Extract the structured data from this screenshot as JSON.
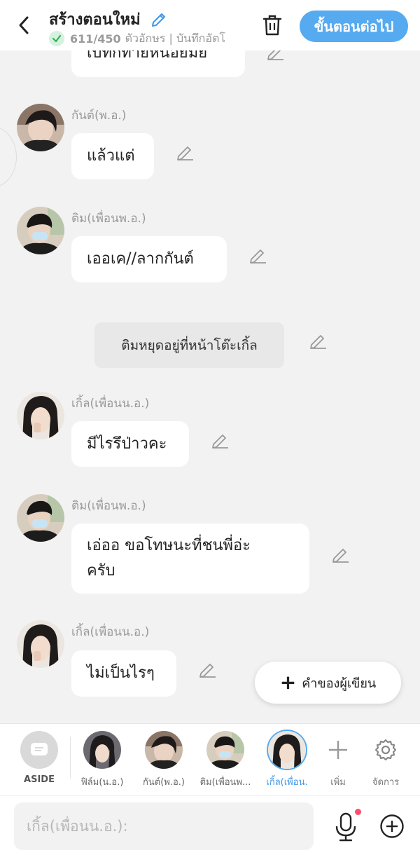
{
  "header": {
    "title": "สร้างตอนใหม่",
    "char_count": "611/450",
    "status": "ตัวอักษร | บันทึกอัตโ",
    "next_label": "ขั้นตอนต่อไป"
  },
  "messages": {
    "prev_partial": "เบทกทายหนอยมย",
    "m1": {
      "speaker": "กันต์(พ.อ.)",
      "text": "แล้วแต่"
    },
    "m2": {
      "speaker": "ติม(เพื่อนพ.อ.)",
      "text": "เออเค//ลากกันต์"
    },
    "narration": "ติมหยุดอยู่ที่หน้าโต๊ะเกิ้ล",
    "m3": {
      "speaker": "เกิ้ล(เพื่อนน.อ.)",
      "text": "มีไรรึป่าวคะ"
    },
    "m4": {
      "speaker": "ติม(เพื่อนพ.อ.)",
      "line1": "เอ่ออ  ขอโทษนะที่ชนพี่อ่ะ",
      "line2": "ครับ"
    },
    "m5": {
      "speaker": "เกิ้ล(เพื่อนน.อ.)",
      "text": "ไม่เป็นไรๆ"
    }
  },
  "writer_button": {
    "label": "คำของผู้เขียน"
  },
  "characters": {
    "aside": "ASIDE",
    "c1": "ฟิล์ม(น.อ.)",
    "c2": "กันต์(พ.อ.)",
    "c3": "ติม(เพื่อนพ...",
    "c4": "เกิ้ล(เพื่อน.",
    "add": "เพิ่ม",
    "manage": "จัดการ"
  },
  "input": {
    "placeholder": "เกิ้ล(เพื่อนน.อ.):"
  },
  "colors": {
    "accent": "#56aaf0",
    "background": "#f2f2f2",
    "notification": "#ff4d6a"
  }
}
